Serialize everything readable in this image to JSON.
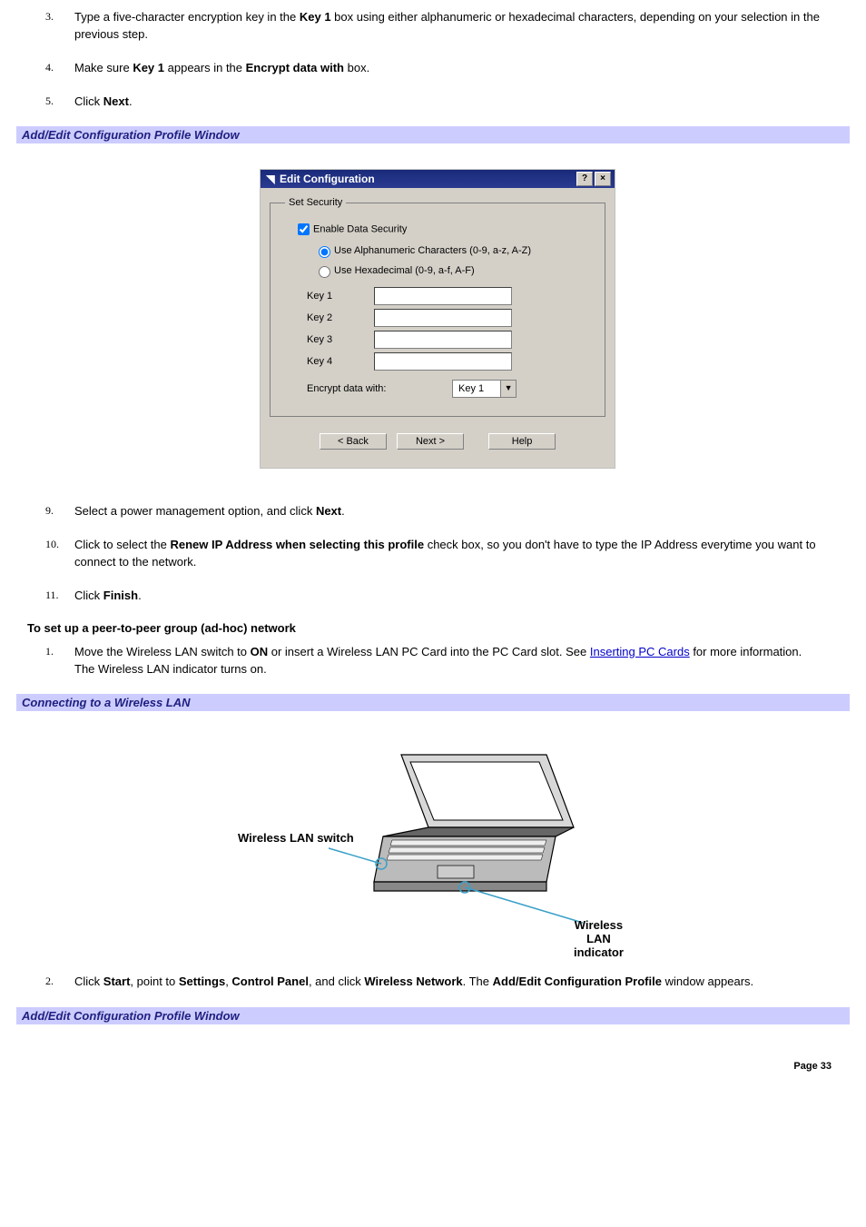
{
  "steps1": [
    {
      "num": "3.",
      "pre": "Type a five-character encryption key in the ",
      "b1": "Key 1",
      "post": " box using either alphanumeric or hexadecimal characters, depending on your selection in the previous step."
    },
    {
      "num": "4.",
      "pre": "Make sure ",
      "b1": "Key 1",
      "mid": " appears in the ",
      "b2": "Encrypt data with",
      "post": " box."
    },
    {
      "num": "5.",
      "pre": "Click ",
      "b1": "Next",
      "post": "."
    }
  ],
  "bar1": "Add/Edit Configuration Profile Window",
  "dialog": {
    "title": "Edit Configuration",
    "help": "?",
    "close": "×",
    "group": "Set Security",
    "chk": "Enable Data Security",
    "rad1": "Use Alphanumeric Characters (0-9, a-z, A-Z)",
    "rad2": "Use Hexadecimal (0-9, a-f, A-F)",
    "k1": "Key 1",
    "k2": "Key 2",
    "k3": "Key 3",
    "k4": "Key 4",
    "encLabel": "Encrypt data with:",
    "encValue": "Key 1",
    "back": "< Back",
    "next": "Next >",
    "helpb": "Help"
  },
  "steps2": [
    {
      "num": "9.",
      "pre": "Select a power management option, and click ",
      "b1": "Next",
      "post": "."
    },
    {
      "num": "10.",
      "pre": "Click to select the ",
      "b1": "Renew IP Address when selecting this profile",
      "post": " check box, so you don't have to type the IP Address everytime you want to connect to the network."
    },
    {
      "num": "11.",
      "pre": "Click ",
      "b1": "Finish",
      "post": "."
    }
  ],
  "subhead": "To set up a peer-to-peer group (ad-hoc) network",
  "adhoc1": {
    "num": "1.",
    "pre": "Move the Wireless LAN switch to ",
    "b1": "ON",
    "mid": " or insert a Wireless LAN PC Card into the PC Card slot. See ",
    "link": "Inserting PC Cards",
    "post": " for more information.",
    "line2": "The Wireless LAN indicator turns on."
  },
  "bar2": "Connecting to a Wireless LAN",
  "callouts": {
    "switch": "Wireless LAN switch",
    "indicator": "Wireless LAN indicator"
  },
  "adhoc2": {
    "num": "2.",
    "pre": "Click ",
    "b1": "Start",
    "t1": ", point to ",
    "b2": "Settings",
    "t2": ", ",
    "b3": "Control Panel",
    "t3": ", and click ",
    "b4": "Wireless Network",
    "t4": ". The ",
    "b5": "Add/Edit Configuration Profile",
    "post": " window appears."
  },
  "bar3": "Add/Edit Configuration Profile Window",
  "pagenum": "Page 33"
}
